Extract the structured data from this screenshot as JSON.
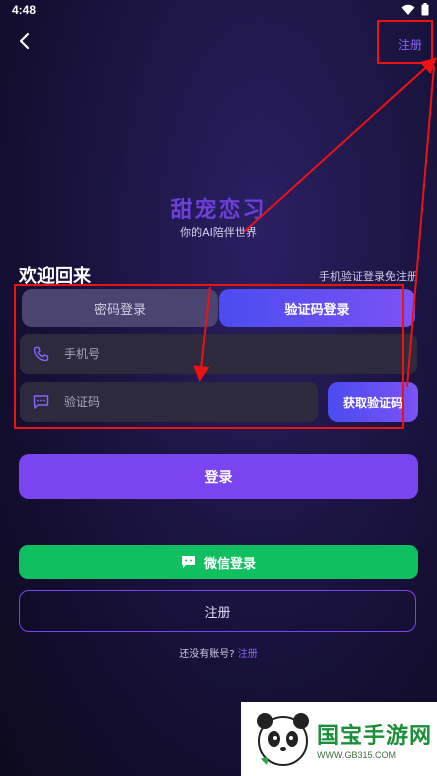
{
  "status_bar": {
    "time": "4:48"
  },
  "header": {
    "register_link": "注册"
  },
  "app": {
    "title": "甜宠恋习",
    "subtitle": "你的AI陪伴世界"
  },
  "welcome": {
    "heading": "欢迎回来",
    "hint": "手机验证登录免注册"
  },
  "tabs": {
    "password": "密码登录",
    "code": "验证码登录",
    "active": "code"
  },
  "form": {
    "phone_placeholder": "手机号",
    "code_placeholder": "验证码",
    "get_code": "获取验证码"
  },
  "buttons": {
    "login": "登录",
    "wechat": "微信登录",
    "register": "注册"
  },
  "footer": {
    "prompt": "还没有账号?",
    "register_link": "注册"
  },
  "watermark": {
    "name": "国宝手游网",
    "url": "WWW.GB315.COM"
  },
  "colors": {
    "accent": "#7a44f0",
    "wechat": "#0fbf60",
    "annotation": "#ee1111"
  },
  "icons": [
    "back-arrow-icon",
    "wifi-icon",
    "battery-icon",
    "phone-icon",
    "message-icon",
    "wechat-icon"
  ]
}
